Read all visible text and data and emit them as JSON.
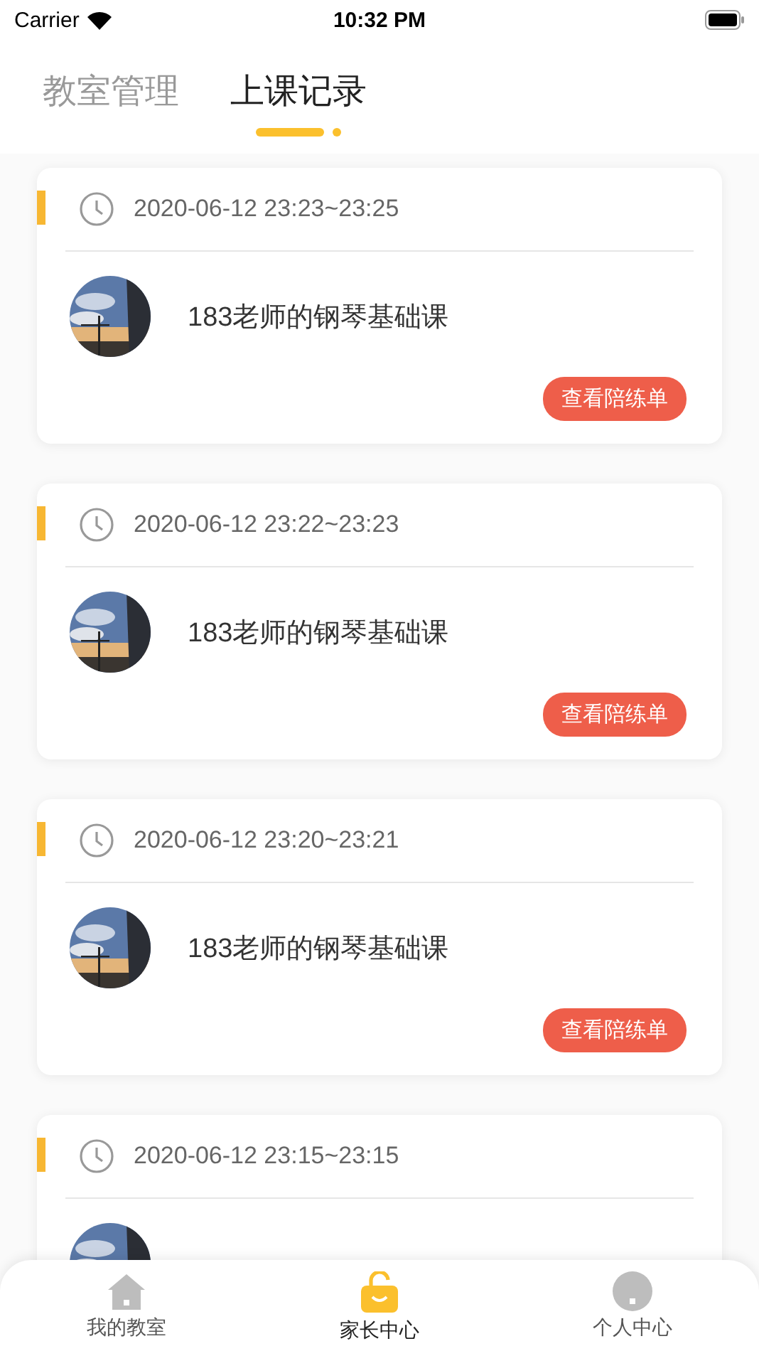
{
  "status_bar": {
    "carrier": "Carrier",
    "time": "10:32 PM"
  },
  "tabs": [
    {
      "label": "教室管理",
      "selected": false
    },
    {
      "label": "上课记录",
      "selected": true
    }
  ],
  "records": [
    {
      "time": "2020-06-12 23:23~23:25",
      "title": "183老师的钢琴基础课",
      "button": "查看陪练单"
    },
    {
      "time": "2020-06-12 23:22~23:23",
      "title": "183老师的钢琴基础课",
      "button": "查看陪练单"
    },
    {
      "time": "2020-06-12 23:20~23:21",
      "title": "183老师的钢琴基础课",
      "button": "查看陪练单"
    },
    {
      "time": "2020-06-12 23:15~23:15"
    }
  ],
  "tab_bar": [
    {
      "label": "我的教室",
      "kind": "home",
      "selected": false
    },
    {
      "label": "家长中心",
      "kind": "bag",
      "selected": true
    },
    {
      "label": "个人中心",
      "kind": "person",
      "selected": false
    }
  ]
}
